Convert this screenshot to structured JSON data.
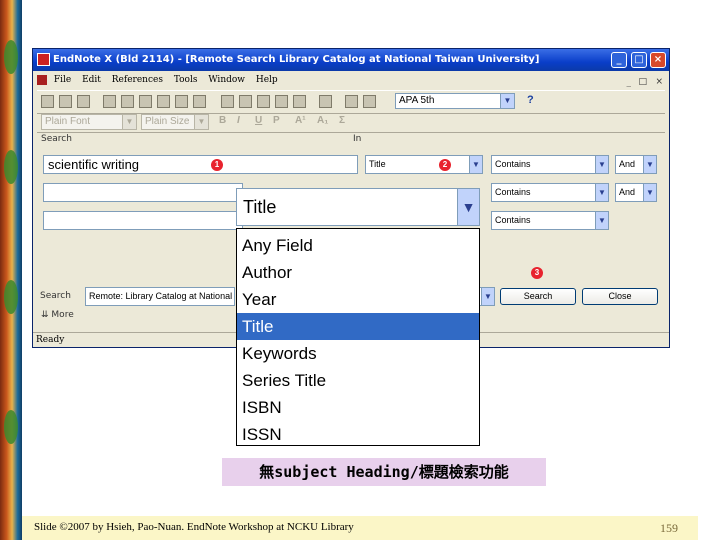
{
  "window": {
    "title": "EndNote X (Bld 2114) - [Remote Search Library Catalog at National Taiwan University]",
    "minimize": "_",
    "maximize": "□",
    "close": "×"
  },
  "menu": {
    "items": [
      "File",
      "Edit",
      "References",
      "Tools",
      "Window",
      "Help"
    ],
    "doc_controls": [
      "_",
      "□",
      "×"
    ]
  },
  "toolbar": {
    "style_value": "APA 5th",
    "help": "?"
  },
  "formatbar": {
    "font": "Plain Font",
    "size": "Plain Size",
    "bold": "B",
    "italic": "I",
    "underline": "U",
    "plain": "P",
    "superscript": "A¹",
    "subscript": "A₁",
    "symbol": "Σ"
  },
  "search": {
    "search_label": "Search",
    "in_label": "In",
    "rows": [
      {
        "term": "scientific writing",
        "field": "Title",
        "op": "Contains",
        "bool": "And"
      },
      {
        "term": "",
        "field": "",
        "op": "Contains",
        "bool": "And"
      },
      {
        "term": "",
        "field": "",
        "op": "Contains",
        "bool": ""
      }
    ],
    "bottom_label": "Search",
    "target": "Remote: Library Catalog at National T",
    "search_button": "Search",
    "close_button": "Close",
    "more": "More"
  },
  "badges": [
    "1",
    "2",
    "3"
  ],
  "status": "Ready",
  "dropdown": {
    "selected": "Title",
    "options": [
      "Any Field",
      "Author",
      "Year",
      "Title",
      "Keywords",
      "Series Title",
      "ISBN",
      "ISSN"
    ],
    "highlight_index": 3
  },
  "caption": "無subject Heading/標題檢索功能",
  "footer": {
    "text": "Slide ©2007 by Hsieh, Pao-Nuan.  EndNote Workshop at NCKU Library",
    "page": "159"
  }
}
